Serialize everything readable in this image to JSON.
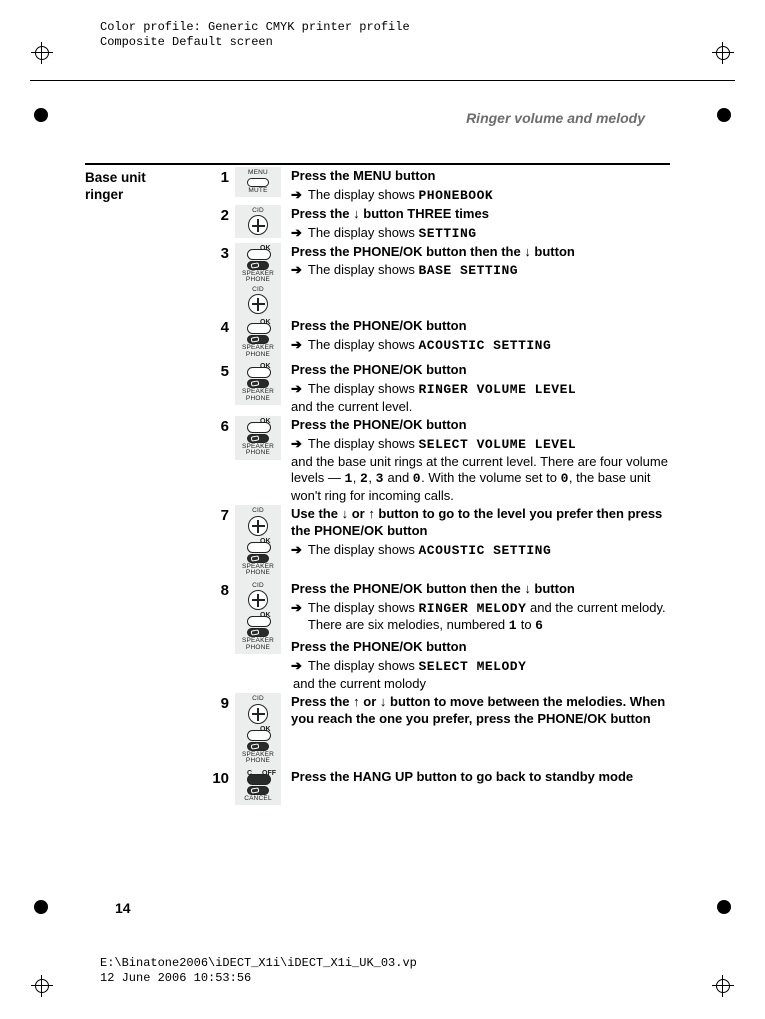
{
  "meta": {
    "color_profile": "Color profile: Generic CMYK printer profile",
    "composite": "Composite  Default screen",
    "file_path": "E:\\Binatone2006\\iDECT_X1i\\iDECT_X1i_UK_03.vp",
    "file_date": "12 June 2006 10:53:56"
  },
  "page": {
    "header": "Ringer volume and melody",
    "section_title": "Base unit\nringer",
    "page_number": "14"
  },
  "icons": {
    "menu_top": "MENU",
    "menu_bot": "MUTE",
    "cid_top": "CID",
    "ok_label": "OK",
    "speaker_bot": "SPEAKER\nPHONE",
    "cancel_top": "C",
    "cancel_off": "OFF",
    "cancel_bot": "CANCEL"
  },
  "steps": [
    {
      "num": "1",
      "icons": [
        "menu"
      ],
      "lead": "Press the <strong>MENU</strong> button",
      "result_prefix": "The display shows",
      "result_display": "PHONEBOOK"
    },
    {
      "num": "2",
      "icons": [
        "plus"
      ],
      "lead": "Press the ↓ button THREE times",
      "result_prefix": "The display shows",
      "result_display": "SETTING"
    },
    {
      "num": "3",
      "icons": [
        "ok",
        "plus"
      ],
      "lead": "Press the <strong>PHONE/OK</strong> button then the ↓ button",
      "result_prefix": "The display shows",
      "result_display": "BASE SETTING"
    },
    {
      "num": "4",
      "icons": [
        "ok"
      ],
      "lead": "Press the <strong>PHONE/OK</strong> button",
      "result_prefix": "The display shows",
      "result_display": "ACOUSTIC SETTING"
    },
    {
      "num": "5",
      "icons": [
        "ok"
      ],
      "lead": "Press the <strong>PHONE/OK</strong> button",
      "result_prefix": "The display shows",
      "result_display": "RINGER VOLUME LEVEL",
      "result_suffix": "and the current level."
    },
    {
      "num": "6",
      "icons": [
        "ok"
      ],
      "lead": "Press the <strong>PHONE/OK</strong> button",
      "result_prefix": "The display shows",
      "result_display": "SELECT VOLUME LEVEL",
      "tail_html": "and the base unit rings at the current level. There are four volume levels — <span class='disp'>1</span>, <span class='disp'>2</span>, <span class='disp'>3</span> and <span class='disp'>0</span>. With the volume set to <span class='disp'>0</span>, the base unit won't ring for incoming calls."
    },
    {
      "num": "7",
      "icons": [
        "plus",
        "ok"
      ],
      "lead": "Use the ↓ or ↑ button to go to the level you prefer then press the <strong>PHONE/OK</strong> button",
      "result_prefix": "The display shows",
      "result_display": "ACOUSTIC SETTING"
    },
    {
      "num": "8",
      "icons": [
        "plus",
        "ok"
      ],
      "lead": "Press the <strong>PHONE/OK</strong> button then the ↓ button",
      "result_prefix": "The display shows",
      "result_display": "RINGER MELODY",
      "result_inline_suffix": " and the current melody. There are six melodies, numbered <span class='disp'>1</span> to <span class='disp'>6</span>",
      "extra_lead": "Press the <strong>PHONE/OK</strong> button",
      "extra_result_prefix": "The display shows",
      "extra_result_display": "SELECT MELODY",
      "extra_result_suffix": "and the current molody"
    },
    {
      "num": "9",
      "icons": [
        "plus",
        "ok"
      ],
      "lead": "Press the ↑ or ↓ button to move between the melodies. When you reach the one you prefer, press the <strong>PHONE/OK</strong> button"
    },
    {
      "num": "10",
      "icons": [
        "cancel"
      ],
      "lead": "Press the <strong>HANG UP</strong> button to go back to standby mode"
    }
  ]
}
